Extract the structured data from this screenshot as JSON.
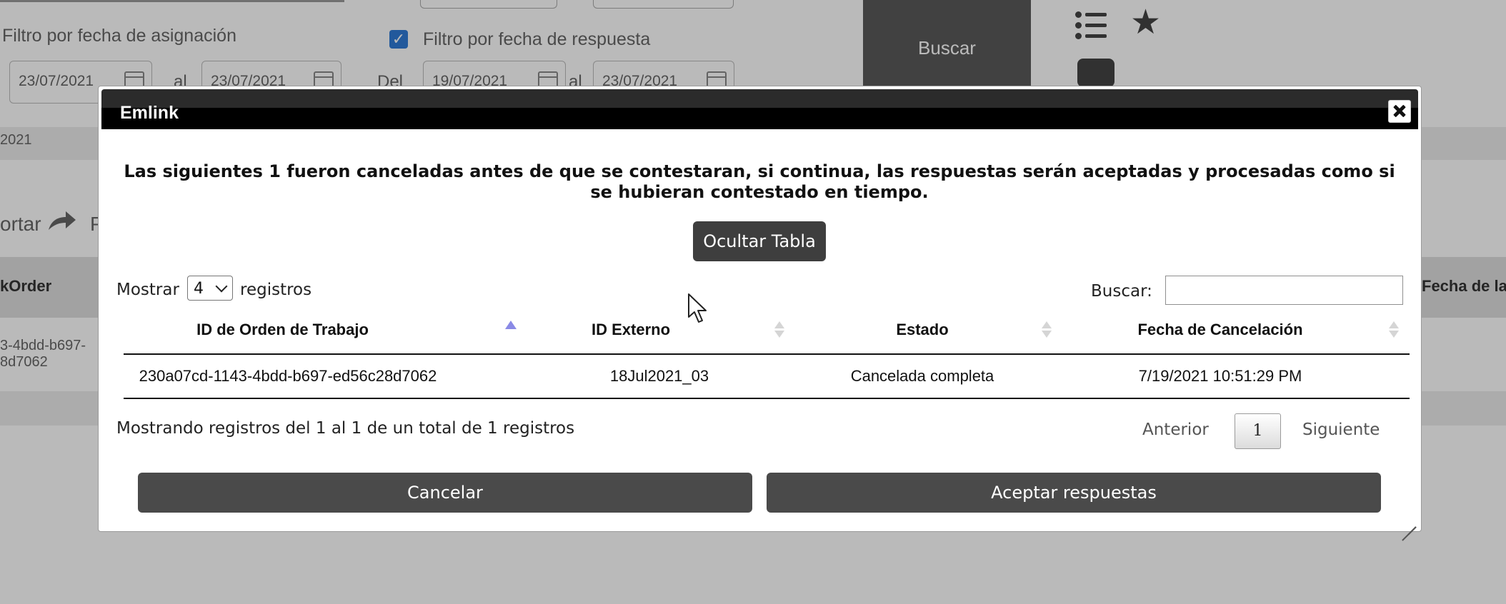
{
  "background": {
    "filters": {
      "assign_label": "Filtro por fecha de asignación",
      "assign_from": "23/07/2021",
      "assign_sep": "al",
      "assign_to": "23/07/2021",
      "response_label": "Filtro por fecha de respuesta",
      "response_checked": true,
      "response_prefix": "Del",
      "response_from": "19/07/2021",
      "response_sep": "al",
      "response_to": "23/07/2021",
      "search_button": "Buscar"
    },
    "date_strip": "2021",
    "toolbar_partial": "ortar",
    "toolbar_partial2": "P",
    "column_partial_left": "kOrder",
    "column_partial_right": "Fecha de la",
    "row_partial_line1": "3-4bdd-b697-",
    "row_partial_line2": "8d7062",
    "icons": [
      "list-icon",
      "star-icon",
      "layout-icon"
    ]
  },
  "dialog": {
    "title": "Emlink",
    "message": "Las siguientes 1 fueron canceladas antes de que se contestaran, si continua, las respuestas serán aceptadas y procesadas como si se hubieran contestado en tiempo.",
    "toggle_button": "Ocultar Tabla",
    "length": {
      "prefix": "Mostrar",
      "value": "4",
      "suffix": "registros"
    },
    "search": {
      "label": "Buscar:",
      "value": ""
    },
    "table": {
      "columns": [
        "ID de Orden de Trabajo",
        "ID Externo",
        "Estado",
        "Fecha de Cancelación"
      ],
      "sorted_column": "ID de Orden de Trabajo",
      "rows": [
        [
          "230a07cd-1143-4bdd-b697-ed56c28d7062",
          "18Jul2021_03",
          "Cancelada completa",
          "7/19/2021 10:51:29 PM"
        ]
      ]
    },
    "info": "Mostrando registros del 1 al 1 de un total de 1 registros",
    "pagination": {
      "previous": "Anterior",
      "current": "1",
      "next": "Siguiente"
    },
    "actions": {
      "cancel": "Cancelar",
      "accept": "Aceptar respuestas"
    }
  }
}
